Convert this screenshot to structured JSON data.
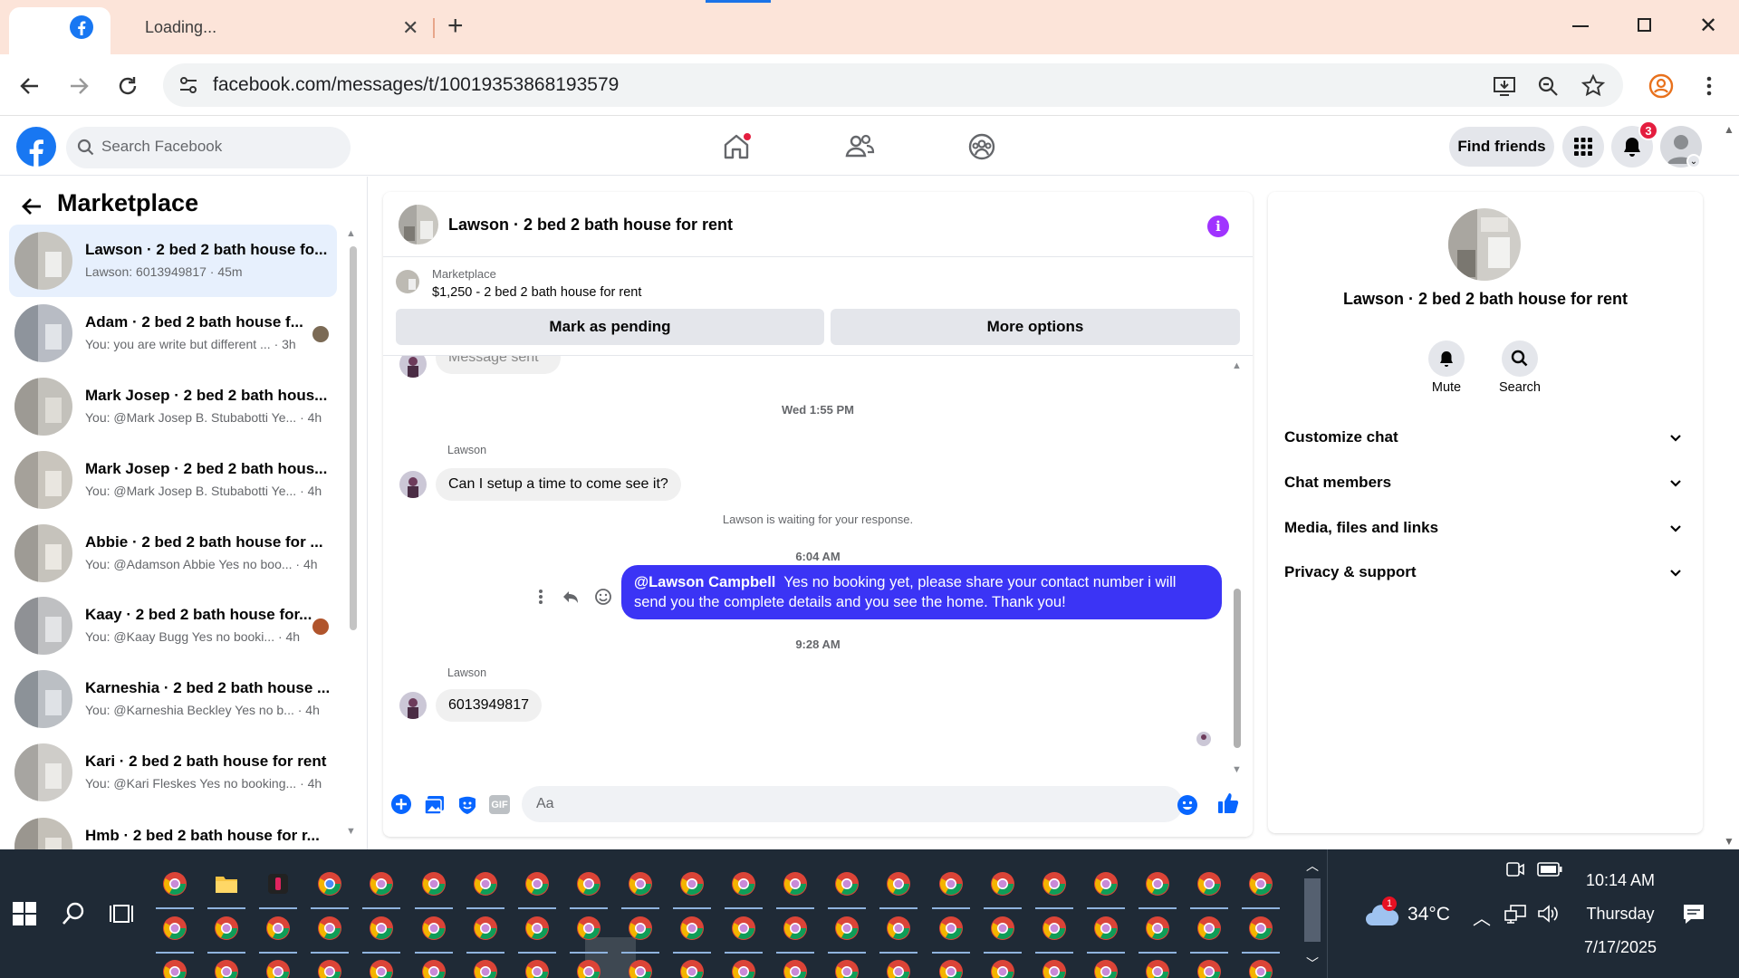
{
  "browser": {
    "tab_title": "Loading...",
    "url": "facebook.com/messages/t/10019353868193579"
  },
  "fb": {
    "search_placeholder": "Search Facebook",
    "find_friends": "Find friends",
    "notif_count": "3"
  },
  "marketplace": {
    "title": "Marketplace",
    "conversations": [
      {
        "title": "Lawson · 2 bed 2 bath house fo...",
        "sub": "Lawson: 6013949817 · 45m"
      },
      {
        "title": "Adam · 2 bed 2 bath house f...",
        "sub": "You: you are write but different ... · 3h"
      },
      {
        "title": "Mark Josep · 2 bed 2 bath hous...",
        "sub": "You: @Mark Josep B. Stubabotti Ye... · 4h"
      },
      {
        "title": "Mark Josep · 2 bed 2 bath hous...",
        "sub": "You: @Mark Josep B. Stubabotti Ye... · 4h"
      },
      {
        "title": "Abbie · 2 bed 2 bath house for ...",
        "sub": "You: @Adamson Abbie Yes no boo... · 4h"
      },
      {
        "title": "Kaay · 2 bed 2 bath house for...",
        "sub": "You: @Kaay Bugg Yes no booki... · 4h"
      },
      {
        "title": "Karneshia · 2 bed 2 bath house ...",
        "sub": "You: @Karneshia Beckley Yes no b... · 4h"
      },
      {
        "title": "Kari · 2 bed 2 bath house for rent",
        "sub": "You: @Kari Fleskes Yes no booking... · 4h"
      },
      {
        "title": "Hmb · 2 bed 2 bath house for r...",
        "sub": ""
      }
    ]
  },
  "chat": {
    "header_title": "Lawson · 2 bed 2 bath house for rent",
    "listing_label": "Marketplace",
    "listing_detail": "$1,250 - 2 bed 2 bath house for rent",
    "mark_pending": "Mark as pending",
    "more_options": "More options",
    "partial_msg": "Message sent",
    "time1": "Wed 1:55 PM",
    "sender1": "Lawson",
    "msg1": "Can I setup a time to come see it?",
    "waiting": "Lawson is waiting for your response.",
    "time2": "6:04 AM",
    "out_mention": "@Lawson Campbell",
    "out_msg": "Yes no booking yet, please share your contact number i will send you the complete details and you see the home. Thank you!",
    "time3": "9:28 AM",
    "sender2": "Lawson",
    "msg2": "6013949817",
    "composer_placeholder": "Aa"
  },
  "info": {
    "title": "Lawson · 2 bed 2 bath house for rent",
    "mute": "Mute",
    "search": "Search",
    "sections": [
      "Customize chat",
      "Chat members",
      "Media, files and links",
      "Privacy & support"
    ]
  },
  "taskbar": {
    "temp": "34°C",
    "weather_badge": "1",
    "time": "10:14 AM",
    "day": "Thursday",
    "date": "7/17/2025"
  },
  "colors": {
    "fb_blue": "#1877f2",
    "bubble_out": "#3b34f5",
    "accent_purple": "#a033ff"
  }
}
